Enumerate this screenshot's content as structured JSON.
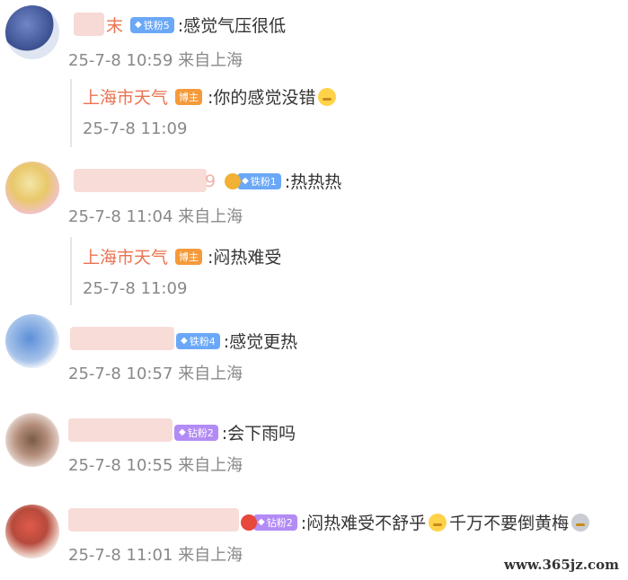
{
  "comments": [
    {
      "name_suffix": "末",
      "badge": "铁粉5",
      "text": ":感觉气压很低",
      "meta": "25-7-8 10:59 来自上海",
      "reply": {
        "name": "上海市天气",
        "badge": "博主",
        "text": ":你的感觉没错",
        "time": "25-7-8 11:09"
      }
    },
    {
      "name_suffix": "9",
      "badge": "铁粉1",
      "text": ":热热热",
      "meta": "25-7-8 11:04 来自上海",
      "reply": {
        "name": "上海市天气",
        "badge": "博主",
        "text": ":闷热难受",
        "time": "25-7-8 11:09"
      }
    },
    {
      "badge": "铁粉4",
      "text": ":感觉更热",
      "meta": "25-7-8 10:57 来自上海"
    },
    {
      "badge": "钻粉2",
      "text": ":会下雨吗",
      "meta": "25-7-8 10:55 来自上海"
    },
    {
      "badge": "钻粉2",
      "text1": ":闷热难受不舒乎",
      "text2": "千万不要倒黄梅",
      "meta": "25-7-8 11:01 来自上海"
    }
  ],
  "watermark": "www.365jz.com",
  "colors": {
    "reply_name": "#eb7350",
    "meta": "#888888",
    "iron_badge": "#6aa8f7",
    "drill_badge": "#b38bf5",
    "host_badge": "#f59a3a"
  }
}
